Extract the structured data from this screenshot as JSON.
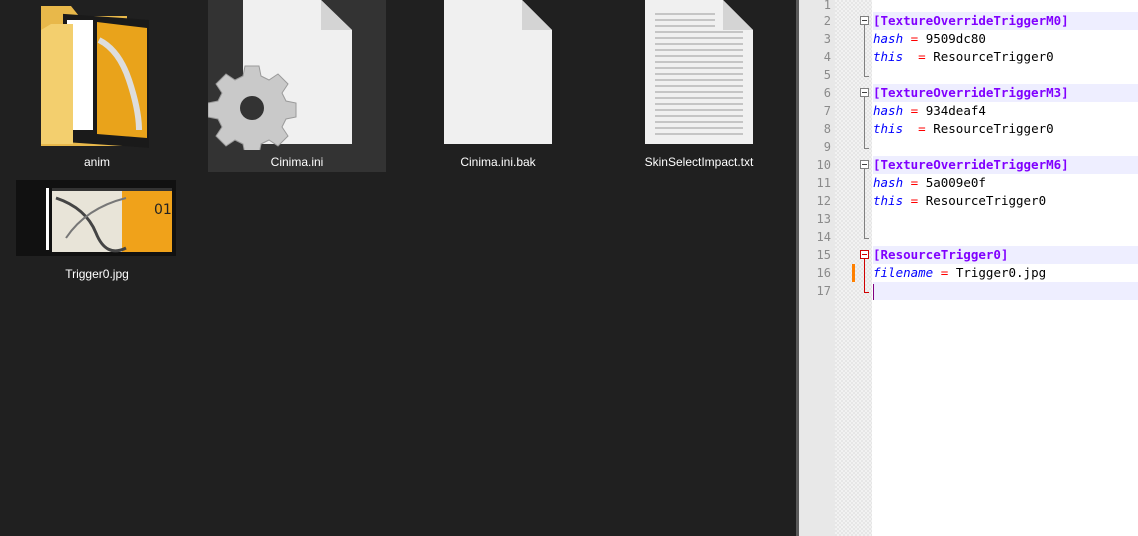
{
  "explorer": {
    "files": [
      {
        "name": "anim",
        "icon": "folder-icon"
      },
      {
        "name": "Cinima.ini",
        "icon": "settings-file-icon",
        "selected": true
      },
      {
        "name": "Cinima.ini.bak",
        "icon": "blank-file-icon"
      },
      {
        "name": "SkinSelectImpact.txt",
        "icon": "text-file-icon"
      },
      {
        "name": "Trigger0.jpg",
        "icon": "image-thumbnail-icon"
      }
    ]
  },
  "editor": {
    "line_numbers": [
      "1",
      "2",
      "3",
      "4",
      "5",
      "6",
      "7",
      "8",
      "9",
      "10",
      "11",
      "12",
      "13",
      "14",
      "15",
      "16",
      "17"
    ],
    "lines": {
      "l2": {
        "section": "[TextureOverrideTriggerM0]"
      },
      "l3": {
        "key": "hash",
        "eq": "=",
        "val": "9509dc80"
      },
      "l4": {
        "key": "this",
        "eq": "=",
        "val": "ResourceTrigger0"
      },
      "l6": {
        "section": "[TextureOverrideTriggerM3]"
      },
      "l7": {
        "key": "hash",
        "eq": "=",
        "val": "934deaf4"
      },
      "l8": {
        "key": "this",
        "eq": "=",
        "val": "ResourceTrigger0"
      },
      "l10": {
        "section": "[TextureOverrideTriggerM6]"
      },
      "l11": {
        "key": "hash",
        "eq": "=",
        "val": "5a009e0f"
      },
      "l12": {
        "key": "this",
        "eq": "=",
        "val": "ResourceTrigger0"
      },
      "l15": {
        "section": "[ResourceTrigger0]"
      },
      "l16": {
        "key": "filename",
        "eq": "=",
        "val": "Trigger0.jpg"
      }
    },
    "colors": {
      "section": "#8000ff",
      "key": "#0000ff",
      "operator": "#ff0000",
      "current_line": "#eeeeff"
    }
  }
}
